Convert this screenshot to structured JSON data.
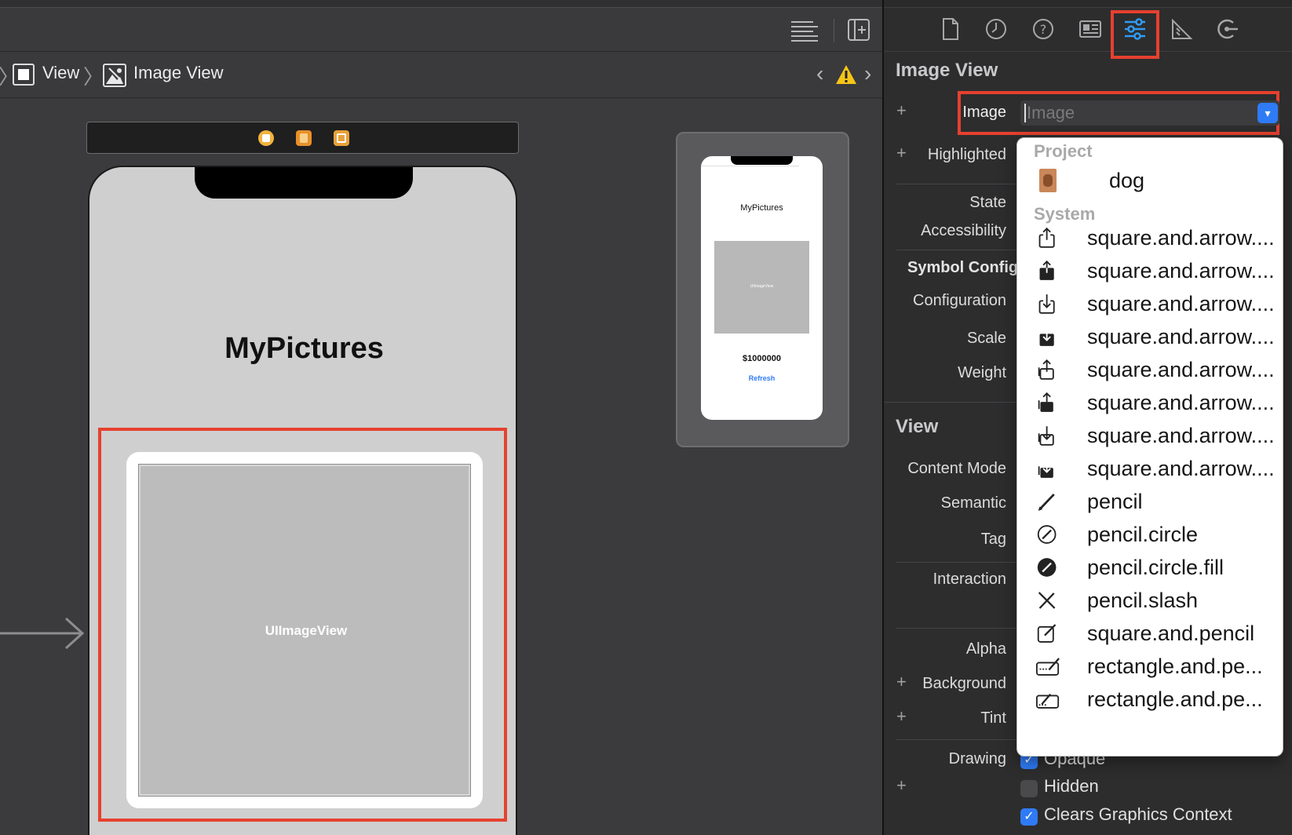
{
  "breadcrumb": {
    "items": [
      {
        "label": "View"
      },
      {
        "label": "Image View"
      }
    ]
  },
  "canvas": {
    "title": "MyPictures",
    "image_view_label": "UIImageView",
    "mini": {
      "title": "MyPictures",
      "image_label": "UIImageView",
      "price": "$1000000",
      "refresh": "Refresh"
    }
  },
  "inspector": {
    "tabs": [
      "file-inspector-icon",
      "history-icon",
      "help-icon",
      "identity-icon",
      "attributes-icon",
      "size-icon",
      "connections-icon"
    ],
    "active_tab": "attributes-icon",
    "image_view_section": {
      "title": "Image View",
      "image_label": "Image",
      "image_placeholder": "Image",
      "highlighted_label": "Highlighted",
      "state_label": "State",
      "accessibility_label": "Accessibility",
      "symbol_config_label": "Symbol Config",
      "configuration_label": "Configuration",
      "scale_label": "Scale",
      "weight_label": "Weight"
    },
    "view_section": {
      "title": "View",
      "content_mode_label": "Content Mode",
      "semantic_label": "Semantic",
      "tag_label": "Tag",
      "interaction_label": "Interaction",
      "alpha_label": "Alpha",
      "background_label": "Background",
      "tint_label": "Tint",
      "drawing_label": "Drawing",
      "opaque_label": "Opaque",
      "hidden_label": "Hidden",
      "clears_label": "Clears Graphics Context"
    }
  },
  "dropdown": {
    "project_header": "Project",
    "project_items": [
      {
        "label": "dog"
      }
    ],
    "system_header": "System",
    "system_items": [
      {
        "label": "square.and.arrow....",
        "icon": "share-icon"
      },
      {
        "label": "square.and.arrow....",
        "icon": "share-fill-icon"
      },
      {
        "label": "square.and.arrow....",
        "icon": "download-icon"
      },
      {
        "label": "square.and.arrow....",
        "icon": "download-fill-icon"
      },
      {
        "label": "square.and.arrow....",
        "icon": "share-stack-icon"
      },
      {
        "label": "square.and.arrow....",
        "icon": "share-stack-fill-icon"
      },
      {
        "label": "square.and.arrow....",
        "icon": "download-stack-icon"
      },
      {
        "label": "square.and.arrow....",
        "icon": "download-stack-fill-icon"
      },
      {
        "label": "pencil",
        "icon": "pencil-icon"
      },
      {
        "label": "pencil.circle",
        "icon": "pencil-circle-icon"
      },
      {
        "label": "pencil.circle.fill",
        "icon": "pencil-circle-fill-icon"
      },
      {
        "label": "pencil.slash",
        "icon": "pencil-slash-icon"
      },
      {
        "label": "square.and.pencil",
        "icon": "square-pencil-icon"
      },
      {
        "label": "rectangle.and.pe...",
        "icon": "rectangle-pencil-icon"
      },
      {
        "label": "rectangle.and.pe...",
        "icon": "rectangle-pencil-2-icon"
      }
    ]
  },
  "colors": {
    "selection": "#e5412f",
    "accent": "#2f7bf5"
  }
}
